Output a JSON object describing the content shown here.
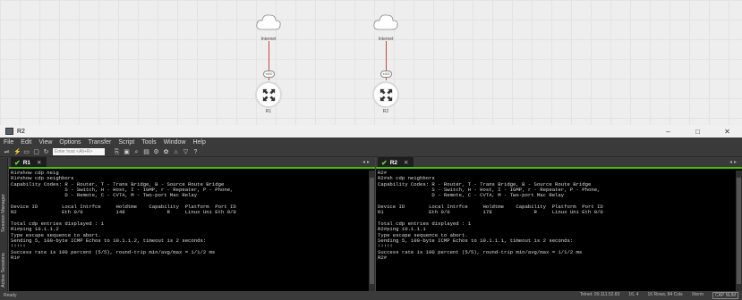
{
  "topology": {
    "nodes": [
      {
        "cloud_label": "Internet",
        "iface_label": "e0/0",
        "router_label": "R1"
      },
      {
        "cloud_label": "Internet",
        "iface_label": "e0/0",
        "router_label": "R2"
      }
    ]
  },
  "window": {
    "title": "R2",
    "controls": [
      "–",
      "□",
      "✕"
    ]
  },
  "menu": [
    "File",
    "Edit",
    "View",
    "Options",
    "Transfer",
    "Script",
    "Tools",
    "Window",
    "Help"
  ],
  "toolbar": {
    "host_placeholder": "Enter host <Alt+R>",
    "icons": [
      "connect-icon",
      "lightning-icon",
      "session-icon",
      "clone-icon",
      "copy-icon",
      "paste-icon",
      "find-icon",
      "print-icon",
      "settings-icon",
      "options-icon",
      "key-icon",
      "filter-icon",
      "help-icon"
    ]
  },
  "sidebar": {
    "tab1": "Session Manager",
    "tab2": "Active Sessions"
  },
  "panes": [
    {
      "tab": "R1",
      "lines": [
        "R1#show cdp neig",
        "R1#show cdp neighbors",
        "Capability Codes: R - Router, T - Trans Bridge, B - Source Route Bridge",
        "                  S - Switch, H - Host, I - IGMP, r - Repeater, P - Phone,",
        "                  D - Remote, C - CVTA, M - Two-port Mac Relay",
        "",
        "Device ID        Local Intrfce     Holdtme    Capability  Platform  Port ID",
        "R2               Eth 0/0           148              R     Linux Uni Eth 0/0",
        "",
        "Total cdp entries displayed : 1",
        "R1#ping 10.1.1.2",
        "Type escape sequence to abort.",
        "Sending 5, 100-byte ICMP Echos to 10.1.1.2, timeout is 2 seconds:",
        "!!!!!",
        "Success rate is 100 percent (5/5), round-trip min/avg/max = 1/1/2 ms",
        "R1#"
      ]
    },
    {
      "tab": "R2",
      "lines": [
        "R2#",
        "R2#sh cdp neighbors",
        "Capability Codes: R - Router, T - Trans Bridge, B - Source Route Bridge",
        "                  S - Switch, H - Host, I - IGMP, r - Repeater, P - Phone,",
        "                  D - Remote, C - CVTA, M - Two-port Mac Relay",
        "",
        "Device ID        Local Intrfce     Holdtme    Capability  Platform  Port ID",
        "R1               Eth 0/0           178              R     Linux Uni Eth 0/0",
        "",
        "Total cdp entries displayed : 1",
        "R2#ping 10.1.1.1",
        "Type escape sequence to abort.",
        "Sending 5, 100-byte ICMP Echos to 10.1.1.1, timeout is 2 seconds:",
        "!!!!!",
        "Success rate is 100 percent (5/5), round-trip min/avg/max = 1/1/2 ms",
        "R2#"
      ]
    }
  ],
  "status": {
    "left": "Ready",
    "telnet": "Telnet: 99.111.52.83",
    "pos": "16,  4",
    "size": "16 Rows, 84 Cols",
    "term": "Xterm",
    "cap": "CAP NUM"
  },
  "colors": {
    "accent_green": "#46c000",
    "terminal_bg": "#000000",
    "terminal_fg": "#dcdcdc"
  }
}
